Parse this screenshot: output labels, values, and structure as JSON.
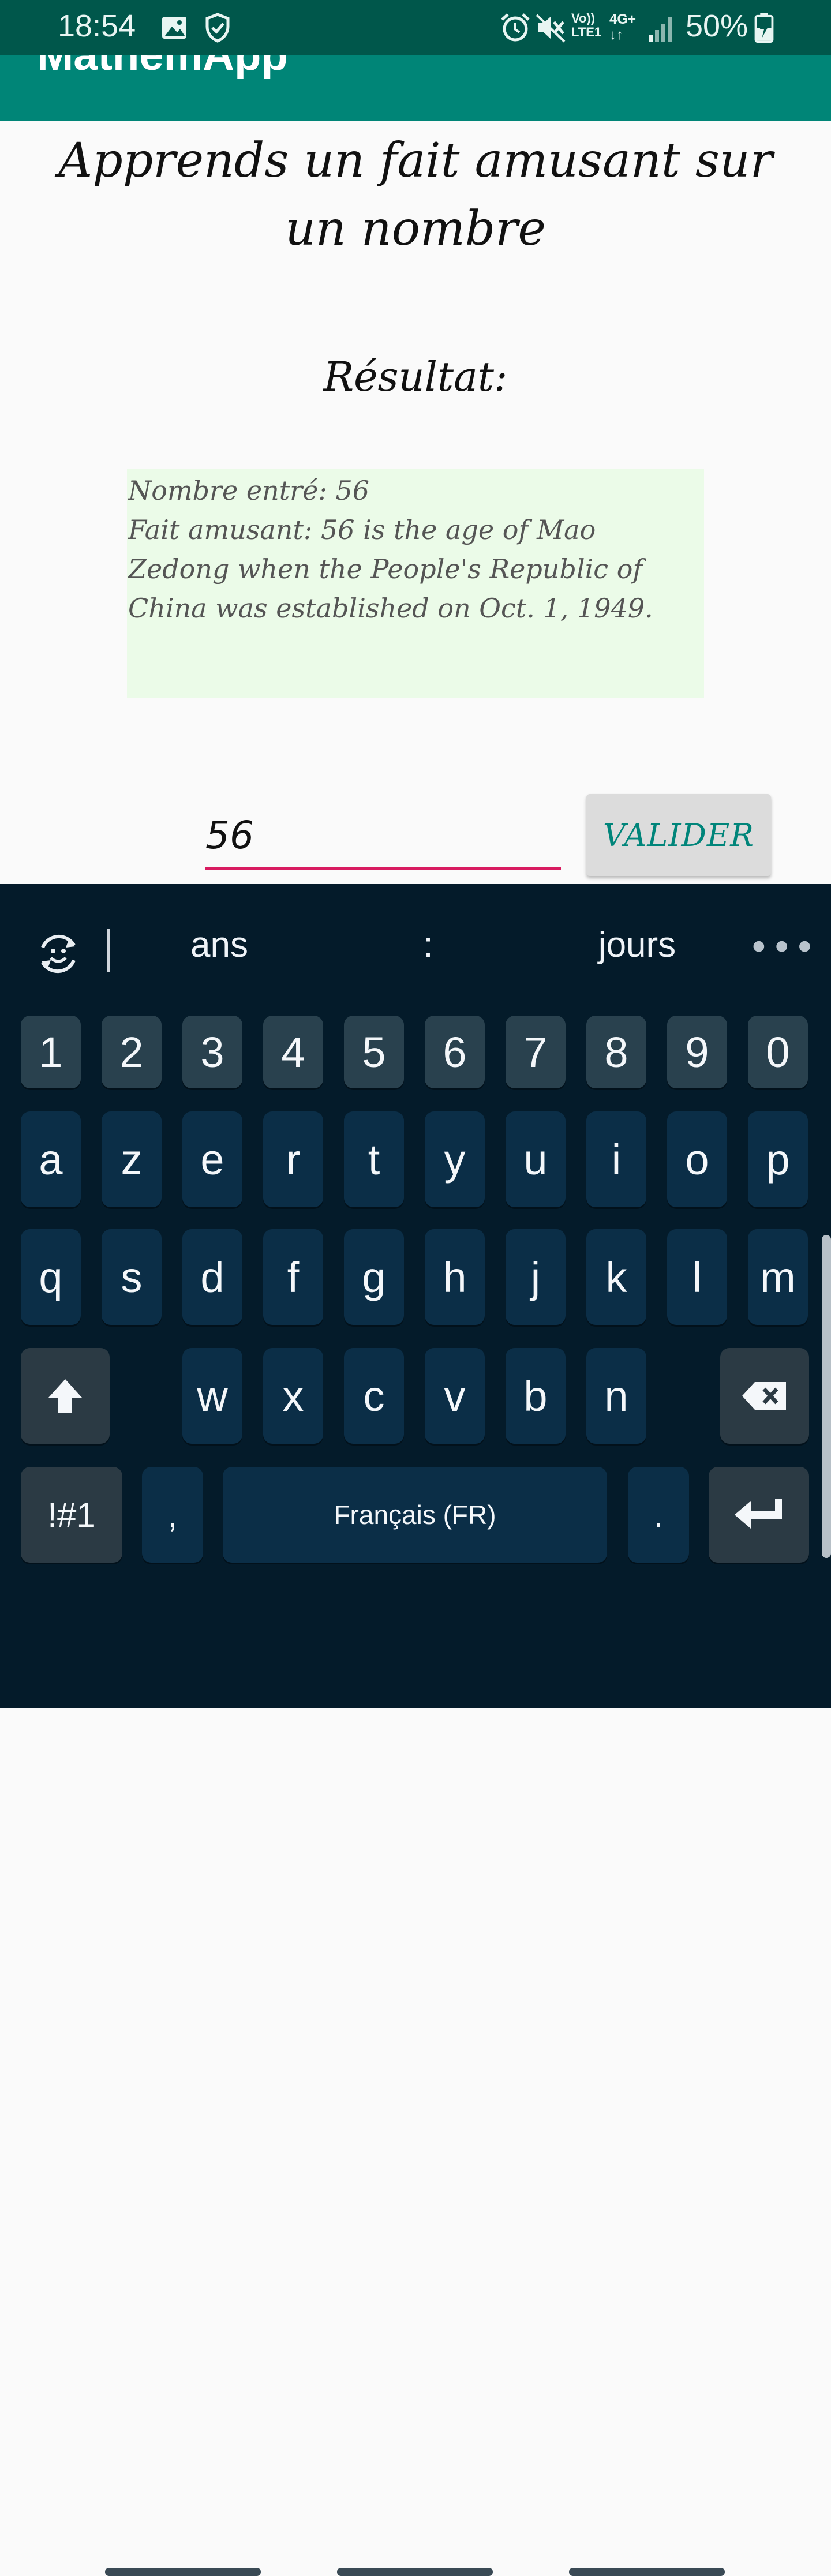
{
  "status_bar": {
    "time": "18:54",
    "battery": "50%",
    "icons": [
      "image-icon",
      "shield-check-icon",
      "alarm-icon",
      "mute-icon",
      "volte-icon",
      "4g-icon",
      "signal-icon",
      "battery-charging-icon"
    ],
    "volte_label": "Vo))\nLTE1",
    "network_label": "4G+"
  },
  "app_bar": {
    "title": "MathemApp"
  },
  "main": {
    "heading": "Apprends un fait amusant sur un nombre",
    "result_label": "Résultat:",
    "result_text": "Nombre entré: 56\n Fait amusant: 56 is the age of Mao Zedong when the People's Republic of China was established on Oct. 1, 1949.",
    "input_value": "56",
    "validate_label": "VALIDER"
  },
  "keyboard": {
    "suggestions": [
      "ans",
      ":",
      "jours"
    ],
    "row_numbers": [
      "1",
      "2",
      "3",
      "4",
      "5",
      "6",
      "7",
      "8",
      "9",
      "0"
    ],
    "row1": [
      "a",
      "z",
      "e",
      "r",
      "t",
      "y",
      "u",
      "i",
      "o",
      "p"
    ],
    "row2": [
      "q",
      "s",
      "d",
      "f",
      "g",
      "h",
      "j",
      "k",
      "l",
      "m"
    ],
    "row3": [
      "w",
      "x",
      "c",
      "v",
      "b",
      "n"
    ],
    "symbols_label": "!#1",
    "comma": ",",
    "space_label": "Français (FR)",
    "period": ".",
    "icons": [
      "emoji-sync-icon",
      "more-icon",
      "shift-icon",
      "backspace-icon",
      "enter-icon"
    ]
  }
}
